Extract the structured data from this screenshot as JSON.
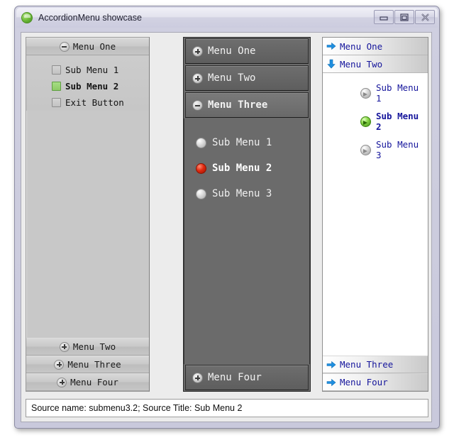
{
  "window": {
    "title": "AccordionMenu showcase",
    "icon": "app-green-orb-icon",
    "buttons": {
      "minimize": "minimize-icon",
      "maximize": "maximize-icon",
      "close": "close-icon"
    }
  },
  "panels": {
    "left": {
      "name": "accordion-light",
      "top_headers": [
        {
          "label": "Menu One",
          "icon": "minus-circle-icon",
          "expanded": true
        }
      ],
      "items": [
        {
          "label": "Sub Menu 1",
          "icon": "checkbox-unchecked-icon",
          "selected": false
        },
        {
          "label": "Sub Menu 2",
          "icon": "checkbox-checked-green-icon",
          "selected": true
        },
        {
          "label": "Exit Button",
          "icon": "checkbox-unchecked-icon",
          "selected": false
        }
      ],
      "bottom_headers": [
        {
          "label": "Menu Two",
          "icon": "plus-circle-icon",
          "expanded": false
        },
        {
          "label": "Menu Three",
          "icon": "plus-circle-icon",
          "expanded": false
        },
        {
          "label": "Menu Four",
          "icon": "plus-circle-icon",
          "expanded": false
        }
      ]
    },
    "middle": {
      "name": "accordion-dark",
      "top_headers": [
        {
          "label": "Menu One",
          "icon": "plus-circle-icon",
          "expanded": false
        },
        {
          "label": "Menu Two",
          "icon": "plus-circle-icon",
          "expanded": false
        },
        {
          "label": "Menu Three",
          "icon": "minus-circle-icon",
          "expanded": true
        }
      ],
      "items": [
        {
          "label": "Sub Menu 1",
          "icon": "sphere-grey-icon",
          "selected": false
        },
        {
          "label": "Sub Menu 2",
          "icon": "sphere-red-icon",
          "selected": true
        },
        {
          "label": "Sub Menu 3",
          "icon": "sphere-grey-icon",
          "selected": false
        }
      ],
      "bottom_headers": [
        {
          "label": "Menu Four",
          "icon": "plus-circle-icon",
          "expanded": false
        }
      ]
    },
    "right": {
      "name": "accordion-blue",
      "top_headers": [
        {
          "label": "Menu One",
          "icon": "arrow-right-blue-icon",
          "expanded": false
        },
        {
          "label": "Menu Two",
          "icon": "arrow-down-blue-icon",
          "expanded": true
        }
      ],
      "items": [
        {
          "label": "Sub Menu 1",
          "icon": "sphere-arrow-grey-icon",
          "selected": false
        },
        {
          "label": "Sub Menu 2",
          "icon": "sphere-arrow-green-icon",
          "selected": true
        },
        {
          "label": "Sub Menu 3",
          "icon": "sphere-arrow-grey-icon",
          "selected": false
        }
      ],
      "bottom_headers": [
        {
          "label": "Menu Three",
          "icon": "arrow-right-blue-icon",
          "expanded": false
        },
        {
          "label": "Menu Four",
          "icon": "arrow-right-blue-icon",
          "expanded": false
        }
      ]
    }
  },
  "statusbar": {
    "text": "Source name: submenu3.2; Source Title: Sub Menu 2"
  },
  "colors": {
    "accent_blue": "#16169c",
    "selected_green": "#8ecb66",
    "selected_red": "#e02a10",
    "arrow_blue": "#1f8fe0",
    "dark_panel": "#6b6b6b",
    "light_panel": "#c8c8c8"
  }
}
